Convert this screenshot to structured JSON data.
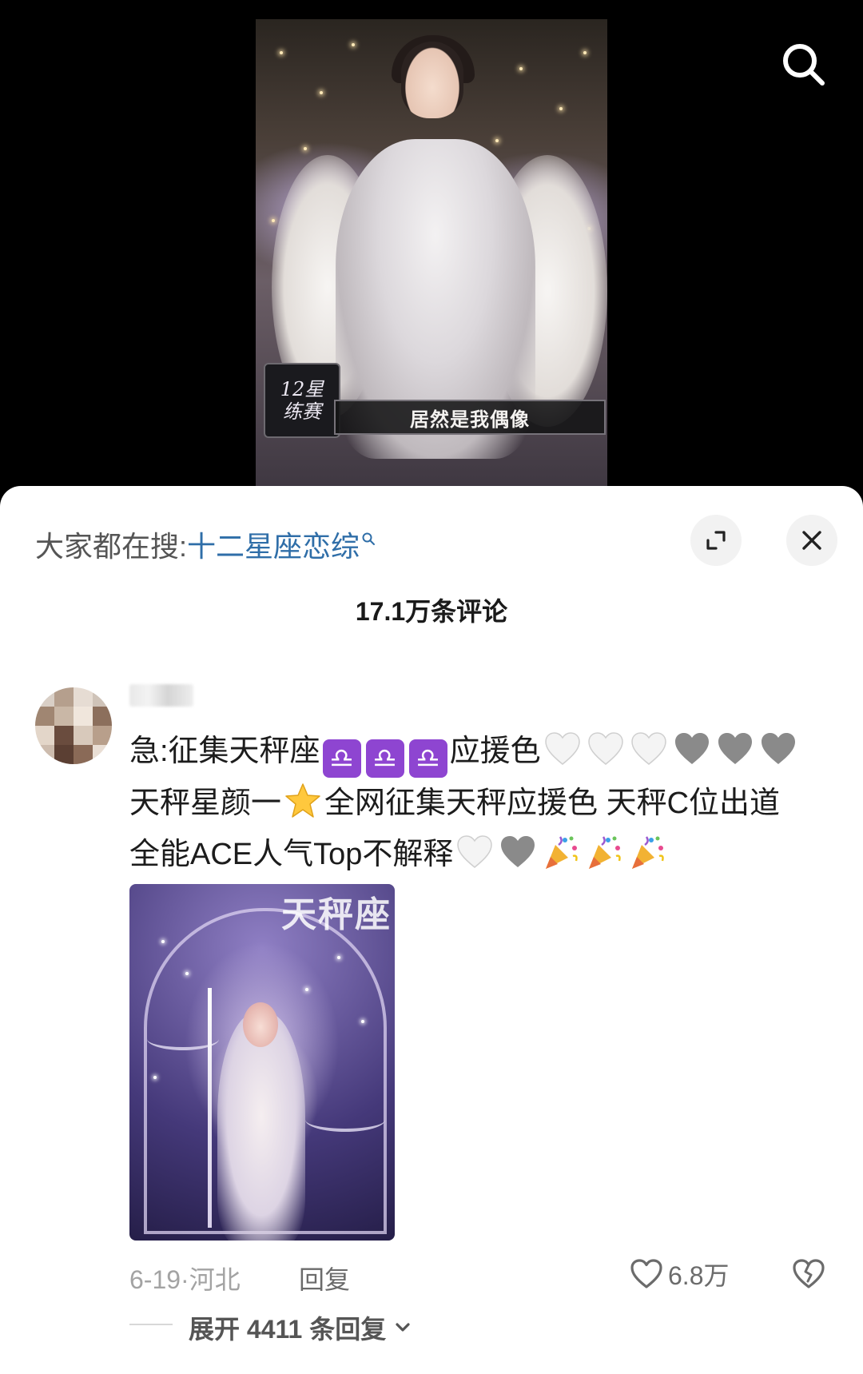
{
  "video": {
    "logo_text": "12星\n练赛",
    "caption": "居然是我偶像"
  },
  "search": {
    "icon": "search-icon"
  },
  "comments_panel": {
    "hot_search_label": "大家都在搜:",
    "hot_search_keyword": "十二星座恋综",
    "comment_count": "17.1万条评论"
  },
  "comment": {
    "line1_prefix": "急:征集天秤座",
    "libra_symbol": "♎",
    "line1_suffix": "应援色",
    "line2_a": "天秤星颜一",
    "line2_b": "全网征集天秤应援色 天秤C位出道",
    "line3": "全能ACE人气Top不解释",
    "image_title": "天秤座",
    "date": "6-19",
    "location": "河北",
    "reply_label": "回复",
    "likes": "6.8万",
    "expand_label": "展开 4411 条回复"
  },
  "colors": {
    "accent_blue": "#2f6ea8",
    "libra_purple": "#8e45d1",
    "meta_gray": "#a3a3a3"
  }
}
